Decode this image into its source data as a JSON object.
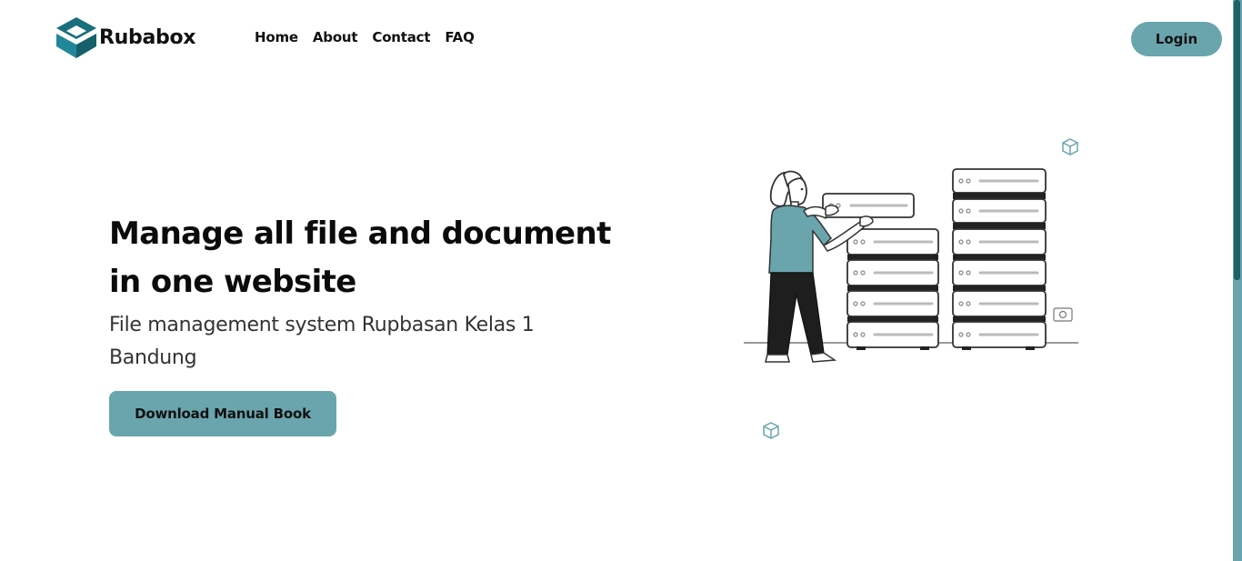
{
  "brand": {
    "name": "Rubabox",
    "logo_icon": "box-logo-icon"
  },
  "nav": {
    "items": [
      "Home",
      "About",
      "Contact",
      "FAQ"
    ]
  },
  "header": {
    "login_label": "Login"
  },
  "hero": {
    "title": "Manage all file and document in one website",
    "subtitle": "File management system Rupbasan Kelas 1 Bandung",
    "download_label": "Download Manual Book"
  },
  "colors": {
    "accent": "#6aa5ad",
    "brand_dark": "#1a6f7c",
    "text": "#111111"
  }
}
